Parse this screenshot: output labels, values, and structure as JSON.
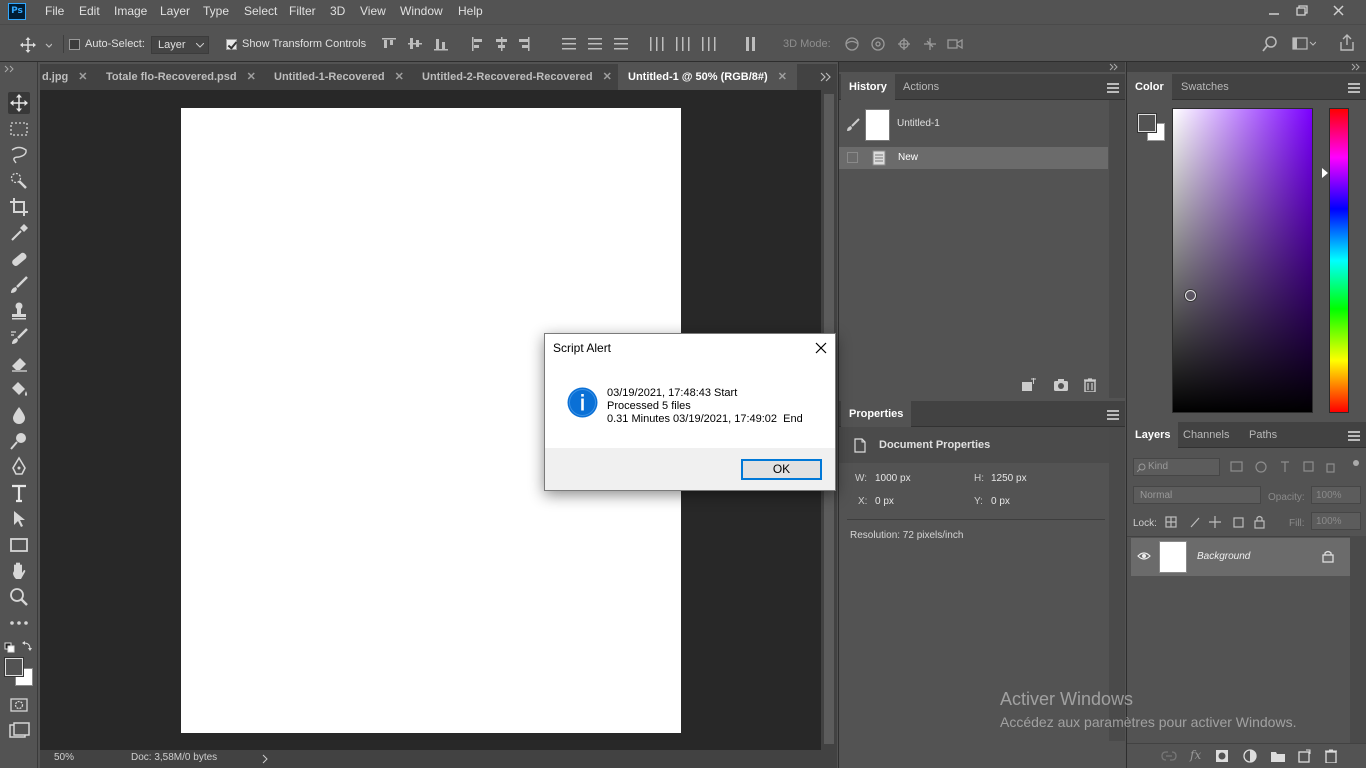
{
  "app": {
    "logo": "Ps",
    "menu": [
      "File",
      "Edit",
      "Image",
      "Layer",
      "Type",
      "Select",
      "Filter",
      "3D",
      "View",
      "Window",
      "Help"
    ]
  },
  "options_bar": {
    "auto_select_label": "Auto-Select:",
    "auto_select_checked": false,
    "target_value": "Layer",
    "show_transform_label": "Show Transform Controls",
    "show_transform_checked": true,
    "mode_3d_label": "3D Mode:"
  },
  "document_tabs": [
    {
      "label": "d.jpg",
      "active": false
    },
    {
      "label": "Totale flo-Recovered.psd",
      "active": false
    },
    {
      "label": "Untitled-1-Recovered",
      "active": false
    },
    {
      "label": "Untitled-2-Recovered-Recovered",
      "active": false
    },
    {
      "label": "Untitled-1 @ 50% (RGB/8#)",
      "active": true
    }
  ],
  "status_bar": {
    "zoom": "50%",
    "doc_info": "Doc: 3,58M/0 bytes"
  },
  "history_panel": {
    "tabs": [
      "History",
      "Actions"
    ],
    "snapshot_label": "Untitled-1",
    "states": [
      "New"
    ]
  },
  "properties_panel": {
    "tab": "Properties",
    "section_title": "Document Properties",
    "w_label": "W:",
    "w_value": "1000 px",
    "h_label": "H:",
    "h_value": "1250 px",
    "x_label": "X:",
    "x_value": "0 px",
    "y_label": "Y:",
    "y_value": "0 px",
    "resolution": "Resolution: 72 pixels/inch"
  },
  "color_panel": {
    "tabs": [
      "Color",
      "Swatches"
    ],
    "hue_color": "#7b00ff"
  },
  "layers_panel": {
    "tabs": [
      "Layers",
      "Channels",
      "Paths"
    ],
    "filter_placeholder": "Kind",
    "blend_mode": "Normal",
    "opacity_label": "Opacity:",
    "opacity_value": "100%",
    "lock_label": "Lock:",
    "fill_label": "Fill:",
    "fill_value": "100%",
    "layers": [
      {
        "name": "Background",
        "visible": true,
        "locked": true
      }
    ]
  },
  "dialog": {
    "title": "Script Alert",
    "line1": "03/19/2021, 17:48:43 Start",
    "line2": "Processed 5 files",
    "line3": "0.31 Minutes 03/19/2021, 17:49:02  End",
    "ok_label": "OK"
  },
  "watermark": {
    "title": "Activer Windows",
    "subtitle": "Accédez aux paramètres pour activer Windows."
  }
}
